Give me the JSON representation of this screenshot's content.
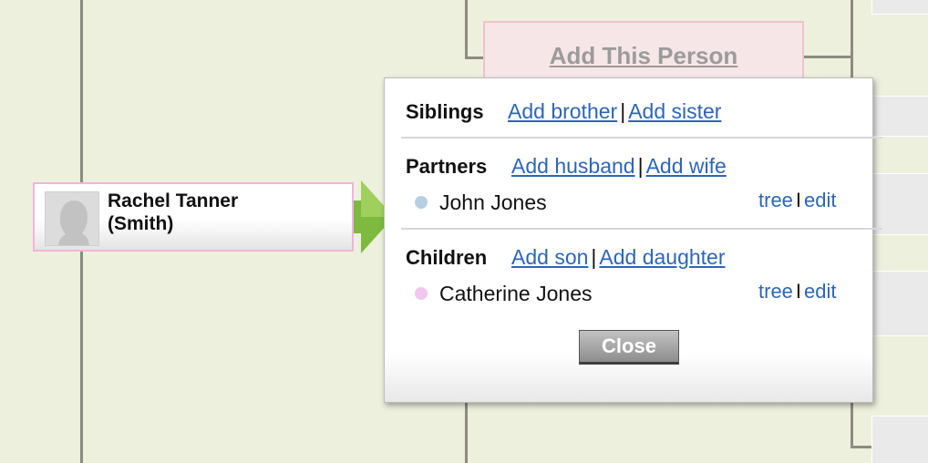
{
  "tree": {
    "add_person_label": "Add This Person"
  },
  "person": {
    "name_line1": "Rachel Tanner",
    "name_line2": "(Smith)"
  },
  "popup": {
    "siblings": {
      "title": "Siblings",
      "add_brother": "Add brother",
      "add_sister": "Add sister",
      "separator": "|"
    },
    "partners": {
      "title": "Partners",
      "add_husband": "Add husband",
      "add_wife": "Add wife",
      "separator": "|",
      "items": [
        {
          "name": "John Jones",
          "dot_color": "#b7cfe0",
          "tree_label": "tree",
          "edit_label": "edit"
        }
      ]
    },
    "children": {
      "title": "Children",
      "add_son": "Add son",
      "add_daughter": "Add daughter",
      "separator": "|",
      "items": [
        {
          "name": "Catherine Jones",
          "dot_color": "#f3c6ee",
          "tree_label": "tree",
          "edit_label": "edit"
        }
      ]
    },
    "item_link_separator": "I",
    "close_label": "Close"
  },
  "colors": {
    "background": "#eef0de",
    "link": "#2d66b7",
    "female_border": "#f2b3dd",
    "arrow": "#7dba3f"
  }
}
